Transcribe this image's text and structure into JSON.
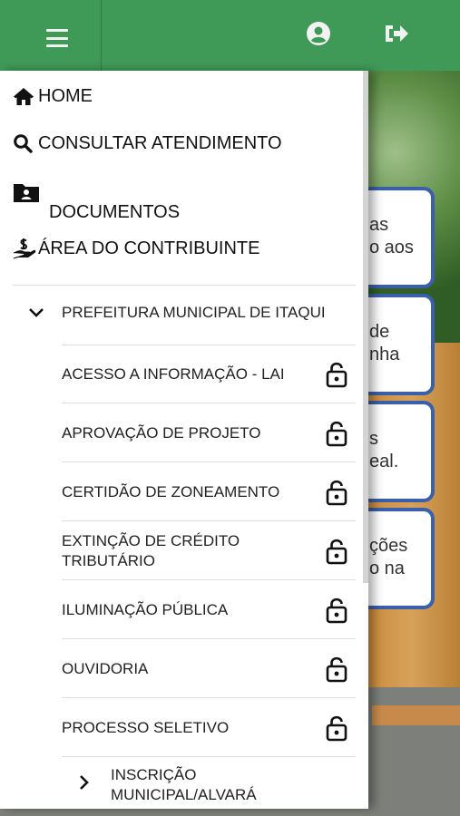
{
  "nav": {
    "home": "HOME",
    "consultar": "CONSULTAR ATENDIMENTO",
    "documentos": "DOCUMENTOS",
    "area": "ÁREA DO CONTRIBUINTE"
  },
  "group": {
    "title": "PREFEITURA MUNICIPAL DE ITAQUI",
    "items": [
      {
        "label": "ACESSO A INFORMAÇÃO - LAI",
        "icon": "lock-icon"
      },
      {
        "label": "APROVAÇÃO DE PROJETO",
        "icon": "lock-icon"
      },
      {
        "label": "CERTIDÃO DE ZONEAMENTO",
        "icon": "lock-icon"
      },
      {
        "label": "EXTINÇÃO DE CRÉDITO TRIBUTÁRIO",
        "icon": "lock-icon"
      },
      {
        "label": "ILUMINAÇÃO PÚBLICA",
        "icon": "lock-icon"
      },
      {
        "label": "OUVIDORIA",
        "icon": "lock-icon"
      },
      {
        "label": "PROCESSO SELETIVO",
        "icon": "lock-icon"
      }
    ],
    "subgroup": "INSCRIÇÃO MUNICIPAL/ALVARÁ"
  },
  "background_cards": [
    {
      "line1": "as",
      "line2": "o aos"
    },
    {
      "line1": "de",
      "line2": "nha"
    },
    {
      "line1": "s",
      "line2": "eal."
    },
    {
      "line1": "ções",
      "line2": "o na"
    }
  ],
  "colors": {
    "topbar": "#3f9a57",
    "card_border": "#3b5fa8"
  }
}
